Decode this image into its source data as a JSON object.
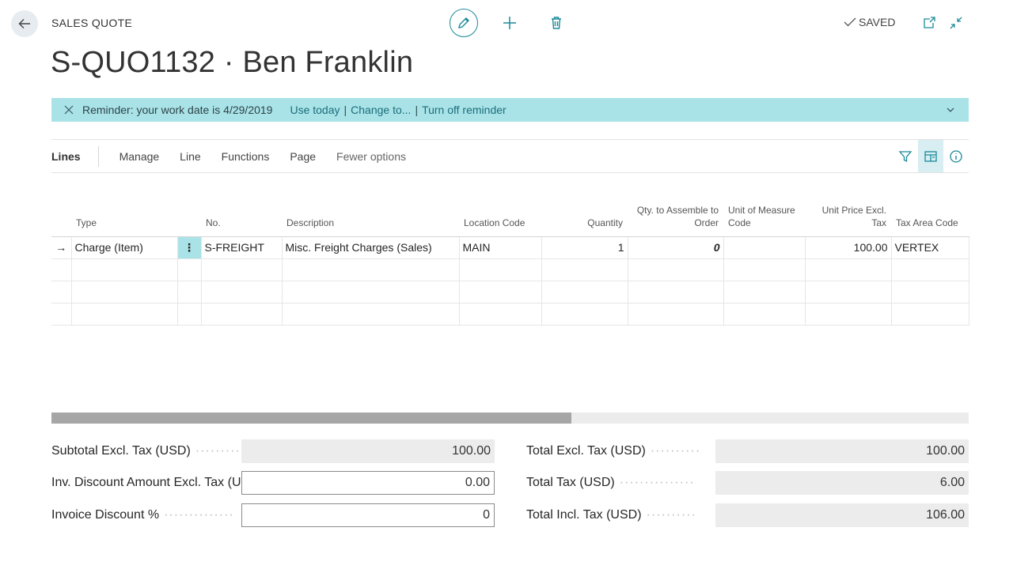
{
  "header": {
    "page_kind": "SALES QUOTE",
    "title": "S-QUO1132 · Ben Franklin",
    "saved_label": "SAVED"
  },
  "reminder": {
    "text": "Reminder: your work date is 4/29/2019",
    "actions": [
      "Use today",
      "Change to...",
      "Turn off reminder"
    ]
  },
  "lines": {
    "label": "Lines",
    "menu": [
      "Manage",
      "Line",
      "Functions",
      "Page",
      "Fewer options"
    ],
    "columns": [
      "Type",
      "No.",
      "Description",
      "Location Code",
      "Quantity",
      "Qty. to Assemble to Order",
      "Unit of Measure Code",
      "Unit Price Excl. Tax",
      "Tax Area Code"
    ],
    "rows": [
      {
        "type": "Charge (Item)",
        "no": "S-FREIGHT",
        "description": "Misc. Freight Charges (Sales)",
        "location": "MAIN",
        "quantity": "1",
        "qty_assemble": "0",
        "uom": "",
        "unit_price": "100.00",
        "tax_area": "VERTEX"
      }
    ],
    "scroll_fraction": 0.567
  },
  "totals": {
    "subtotal_label": "Subtotal Excl. Tax (USD)",
    "subtotal_value": "100.00",
    "inv_discount_label": "Inv. Discount Amount Excl. Tax (U...",
    "inv_discount_value": "0.00",
    "invoice_discount_pct_label": "Invoice Discount %",
    "invoice_discount_pct_value": "0",
    "total_excl_label": "Total Excl. Tax (USD)",
    "total_excl_value": "100.00",
    "total_tax_label": "Total Tax (USD)",
    "total_tax_value": "6.00",
    "total_incl_label": "Total Incl. Tax (USD)",
    "total_incl_value": "106.00"
  },
  "icons": {
    "back": "arrow-left-icon",
    "edit": "pencil-icon",
    "new": "plus-icon",
    "delete": "trash-icon",
    "saved": "checkmark-icon",
    "popout": "open-new-window-icon",
    "collapse": "collapse-icon",
    "filter": "filter-icon",
    "factbox": "factbox-icon",
    "info": "info-icon"
  },
  "colors": {
    "accent": "#1a8a98",
    "reminder_bg": "#a9e3e8",
    "warning_value": "#d0021b"
  }
}
